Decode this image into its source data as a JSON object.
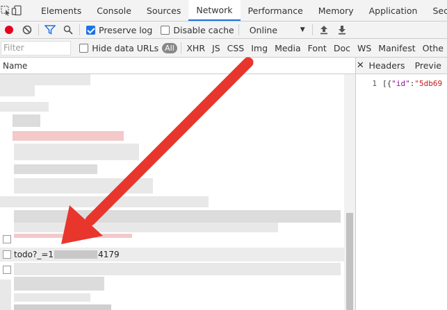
{
  "tabs": [
    {
      "label": "Elements"
    },
    {
      "label": "Console"
    },
    {
      "label": "Sources"
    },
    {
      "label": "Network"
    },
    {
      "label": "Performance"
    },
    {
      "label": "Memory"
    },
    {
      "label": "Application"
    },
    {
      "label": "Security"
    }
  ],
  "toolbar": {
    "preserve_log": "Preserve log",
    "preserve_log_checked": true,
    "disable_cache": "Disable cache",
    "disable_cache_checked": false,
    "throttle": "Online"
  },
  "filter": {
    "placeholder": "Filter",
    "hide_data_urls": "Hide data URLs",
    "types": [
      "All",
      "XHR",
      "JS",
      "CSS",
      "Img",
      "Media",
      "Font",
      "Doc",
      "WS",
      "Manifest",
      "Othe"
    ]
  },
  "table": {
    "name_header": "Name",
    "selected_row": {
      "prefix": "todo?_=1",
      "suffix": "4179"
    }
  },
  "details": {
    "tabs": [
      "Headers",
      "Previe"
    ],
    "line_no": "1",
    "bracket_open": "[{",
    "key": "\"id\"",
    "colon": ":",
    "value": "\"5db69"
  },
  "colors": {
    "accent": "#1a73e8",
    "record": "#e8001c",
    "arrow": "#e8362d"
  }
}
